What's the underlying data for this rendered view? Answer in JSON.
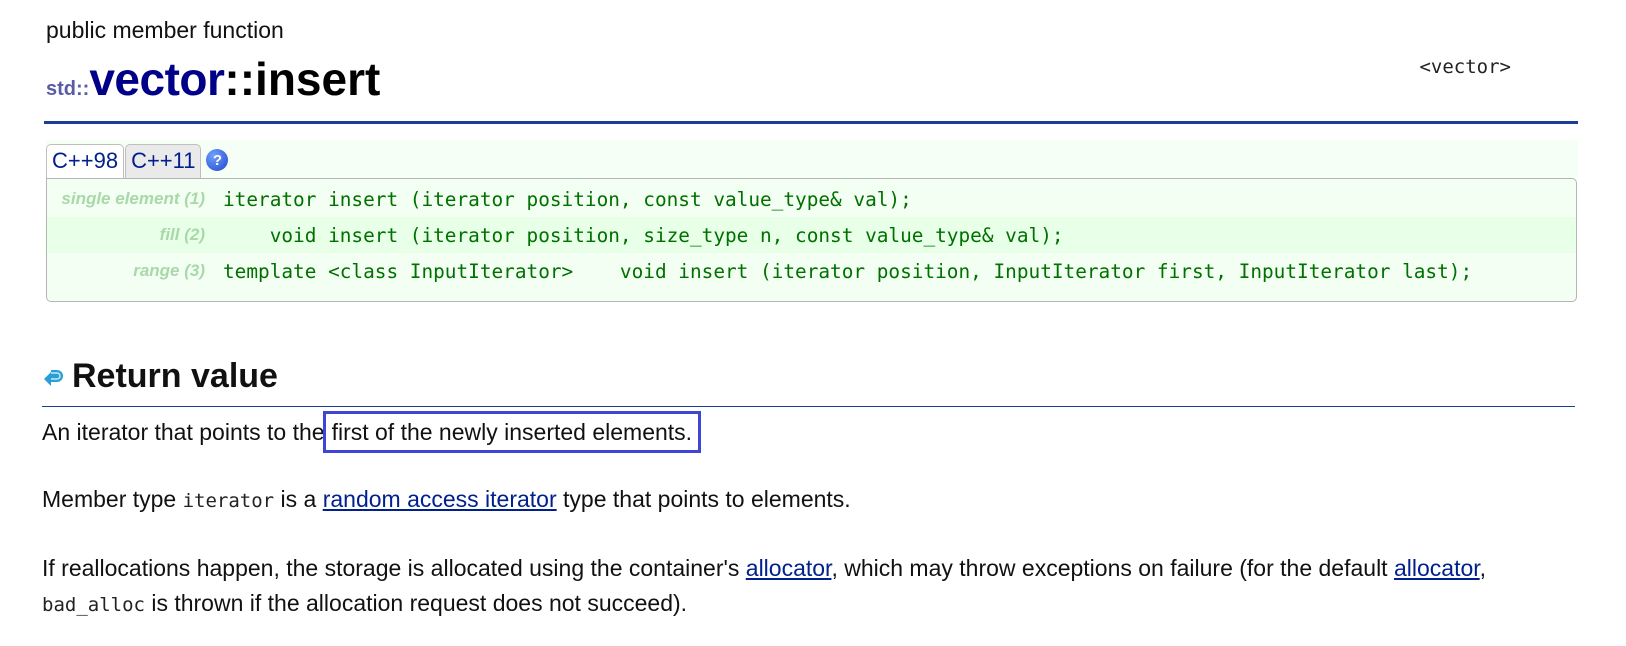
{
  "page": {
    "kind": "public member function",
    "header": "<vector>",
    "title": {
      "namespace": "std::",
      "class": "vector",
      "function": "::insert"
    }
  },
  "tabs": [
    {
      "label": "C++98",
      "active": true
    },
    {
      "label": "C++11",
      "active": false
    }
  ],
  "help_icon": "?",
  "declarations": [
    {
      "label": "single element (1)",
      "code": "iterator insert (iterator position, const value_type& val);"
    },
    {
      "label": "fill (2)",
      "code": "    void insert (iterator position, size_type n, const value_type& val);"
    },
    {
      "label": "range (3)",
      "code": "template <class InputIterator>    void insert (iterator position, InputIterator first, InputIterator last);"
    }
  ],
  "return_value": {
    "heading": "Return value",
    "p1_before": "An iterator that points to the",
    "p1_highlight": "first of the newly inserted elements.",
    "p2_before": "Member type ",
    "p2_code": "iterator",
    "p2_mid": " is a ",
    "p2_link": "random access iterator",
    "p2_after": " type that points to elements.",
    "p3_a": "If reallocations happen, the storage is allocated using the container's ",
    "p3_link1": "allocator",
    "p3_b": ", which may throw exceptions on failure (for the default ",
    "p3_link2": "allocator",
    "p3_c": ",",
    "p3_code": "bad_alloc",
    "p3_d": " is thrown if the allocation request does not succeed)."
  },
  "colors": {
    "class_name": "#000088",
    "rule": "#1c3c96",
    "code": "#007000",
    "link": "#00218d",
    "highlight_box": "#3f46d6"
  }
}
